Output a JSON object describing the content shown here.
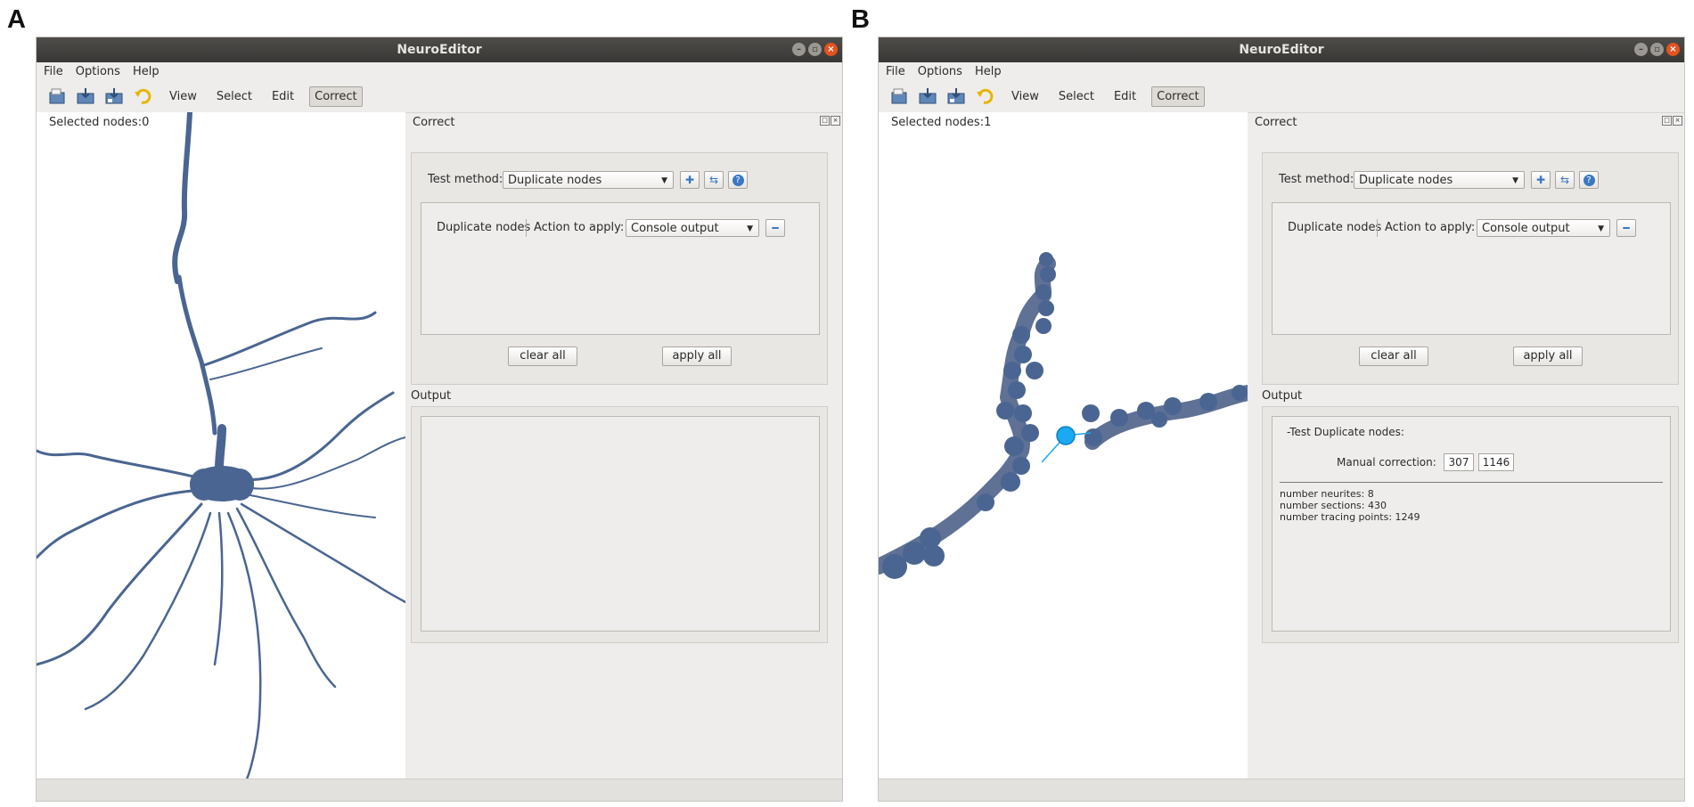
{
  "panel_labels": [
    "A",
    "B"
  ],
  "windows": [
    {
      "title": "NeuroEditor",
      "menu": [
        "File",
        "Options",
        "Help"
      ],
      "toolbar": {
        "view": "View",
        "select": "Select",
        "edit": "Edit",
        "correct": "Correct"
      },
      "selected_nodes": "Selected nodes:0",
      "dock_title": "Correct",
      "test_method_label": "Test method:",
      "test_method_value": "Duplicate nodes",
      "test_name": "Duplicate nodes",
      "action_label": "Action to apply:",
      "action_value": "Console output",
      "clear_all": "clear all",
      "apply_all": "apply all",
      "output_title": "Output",
      "output": null
    },
    {
      "title": "NeuroEditor",
      "menu": [
        "File",
        "Options",
        "Help"
      ],
      "toolbar": {
        "view": "View",
        "select": "Select",
        "edit": "Edit",
        "correct": "Correct"
      },
      "selected_nodes": "Selected nodes:1",
      "dock_title": "Correct",
      "test_method_label": "Test method:",
      "test_method_value": "Duplicate nodes",
      "test_name": "Duplicate nodes",
      "action_label": "Action to apply:",
      "action_value": "Console output",
      "clear_all": "clear all",
      "apply_all": "apply all",
      "output_title": "Output",
      "output": {
        "test_header": "-Test  Duplicate nodes:",
        "manual_correction_label": "Manual correction:",
        "node_a": "307",
        "node_b": "1146",
        "stats": [
          "number neurites: 8",
          "number sections: 430",
          "number tracing points: 1249"
        ]
      }
    }
  ],
  "colors": {
    "neuron": "#4a6591",
    "selected_node": "#1aa9f2",
    "titlebar": "#403e3b",
    "window_bg": "#efedeb"
  },
  "icons": [
    "open-file-icon",
    "save-icon",
    "save-as-icon",
    "undo-icon",
    "add-icon",
    "edit-test-icon",
    "help-icon",
    "remove-icon",
    "close-icon",
    "maximize-icon",
    "minimize-icon"
  ]
}
